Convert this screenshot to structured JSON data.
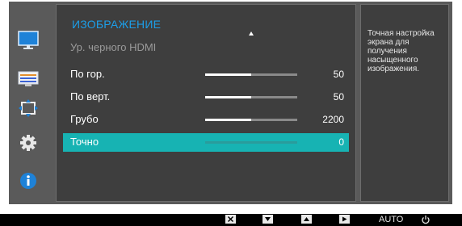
{
  "sidebar": {
    "icons": [
      "monitor-icon",
      "monitor-settings-icon",
      "resize-arrows-icon",
      "gear-icon",
      "info-icon"
    ]
  },
  "menu": {
    "title": "ИЗОБРАЖЕНИЕ",
    "items": [
      {
        "label": "Ур. черного HDMI",
        "state": "disabled"
      },
      {
        "label": "По гор.",
        "value": "50",
        "fill_fraction": 0.5
      },
      {
        "label": "По верт.",
        "value": "50",
        "fill_fraction": 0.5
      },
      {
        "label": "Грубо",
        "value": "2200",
        "fill_fraction": 0.5
      },
      {
        "label": "Точно",
        "value": "0",
        "fill_fraction": 0.0,
        "state": "selected"
      }
    ]
  },
  "help": {
    "text": "Точная настройка экрана для получения насыщенного изображения."
  },
  "bottom_bar": {
    "buttons": [
      "close-icon",
      "down-icon",
      "up-icon",
      "enter-icon"
    ],
    "auto_label": "AUTO",
    "power_icon": "power-icon"
  },
  "colors": {
    "accent": "#1c9ee8",
    "selected": "#17b3b3"
  }
}
